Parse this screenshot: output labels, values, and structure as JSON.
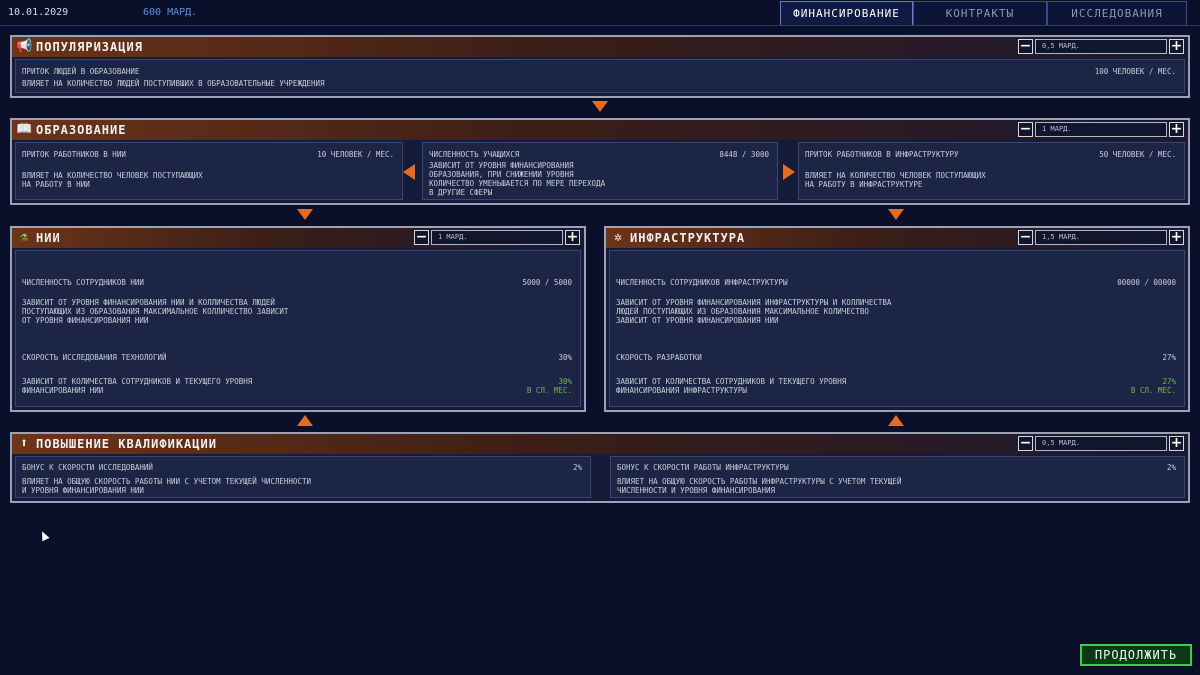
{
  "top": {
    "date": "10.01.2029",
    "money": "600 МАРД."
  },
  "tabs": [
    "ФИНАНСИРОВАНИЕ",
    "КОНТРАКТЫ",
    "ИССЛЕДОВАНИЯ"
  ],
  "popularization": {
    "title": "ПОПУЛЯРИЗАЦИЯ",
    "amount": "0,5 МАРД.",
    "label": "ПРИТОК ЛЮДЕЙ В ОБРАЗОВАНИЕ",
    "value": "100 ЧЕЛОВЕК / МЕС.",
    "desc": "ВЛИЯЕТ НА КОЛИЧЕСТВО ЛЮДЕЙ ПОСТУПИВШИХ В ОБРАЗОВАТЕЛЬНЫЕ УЧРЕЖДЕНИЯ"
  },
  "education": {
    "title": "ОБРАЗОВАНИЕ",
    "amount": "1 МАРД.",
    "left": {
      "label": "ПРИТОК РАБОТНИКОВ В НИИ",
      "value": "10 ЧЕЛОВЕК / МЕС.",
      "desc": "ВЛИЯЕТ НА КОЛИЧЕСТВО ЧЕЛОВЕК ПОСТУПАЮЩИХ\nНА РАБОТУ В НИИ"
    },
    "center": {
      "label": "ЧИСЛЕННОСТЬ УЧАЩИХСЯ",
      "value": "8448 / 3000",
      "desc": "ЗАВИСИТ ОТ УРОВНЯ ФИНАНСИРОВАНИЯ\nОБРАЗОВАНИЯ, ПРИ СНИЖЕНИИ УРОВНЯ\nКОЛИЧЕСТВО УМЕНЬШАЕТСЯ ПО МЕРЕ ПЕРЕХОДА\nВ ДРУГИЕ СФЕРЫ"
    },
    "right": {
      "label": "ПРИТОК РАБОТНИКОВ В ИНФРАСТРУКТУРУ",
      "value": "50 ЧЕЛОВЕК / МЕС.",
      "desc": "ВЛИЯЕТ НА КОЛИЧЕСТВО ЧЕЛОВЕК ПОСТУПАЮЩИХ\nНА РАБОТУ В ИНФРАСТРУКТУРЕ"
    }
  },
  "nii": {
    "title": "НИИ",
    "amount": "1 МАРД.",
    "staff_label": "ЧИСЛЕННОСТЬ СОТРУДНИКОВ НИИ",
    "staff_value": "5000 / 5000",
    "staff_desc": "ЗАВИСИТ ОТ УРОВНЯ ФИНАНСИРОВАНИЯ НИИ И КОЛЛИЧЕСТВА ЛЮДЕЙ\nПОСТУПАЮЩИХ ИЗ ОБРАЗОВАНИЯ МАКСИМАЛЬНОЕ КОЛЛИЧЕСТВО ЗАВИСИТ\nОТ УРОВНЯ ФИНАНСИРОВАНИЯ НИИ",
    "speed_label": "СКОРОСТЬ ИССЛЕДОВАНИЯ ТЕХНОЛОГИЙ",
    "speed_value": "30%",
    "speed_desc": "ЗАВИСИТ ОТ КОЛИЧЕСТВА СОТРУДНИКОВ И ТЕКУЩЕГО УРОВНЯ\nФИНАНСИРОВАНИЯ НИИ",
    "speed_delta": "30%",
    "speed_delta_unit": "В СЛ. МЕС."
  },
  "infra": {
    "title": "ИНФРАСТРУКТУРА",
    "amount": "1,5 МАРД.",
    "staff_label": "ЧИСЛЕННОСТЬ СОТРУДНИКОВ ИНФРАСТРУКТУРЫ",
    "staff_value": "00000 / 00000",
    "staff_desc": "ЗАВИСИТ ОТ УРОВНЯ ФИНАНСИРОВАНИЯ ИНФРАСТРУКТУРЫ И КОЛЛИЧЕСТВА\nЛЮДЕЙ ПОСТУПАЮЩИХ ИЗ ОБРАЗОВАНИЯ МАКСИМАЛЬНОЕ КОЛИЧЕСТВО\nЗАВИСИТ ОТ УРОВНЯ ФИНАНСИРОВАНИЯ НИИ",
    "speed_label": "СКОРОСТЬ РАЗРАБОТКИ",
    "speed_value": "27%",
    "speed_desc": "ЗАВИСИТ ОТ КОЛИЧЕСТВА СОТРУДНИКОВ И ТЕКУЩЕГО УРОВНЯ\nФИНАНСИРОВАНИЯ ИНФРАСТРУКТУРЫ",
    "speed_delta": "27%",
    "speed_delta_unit": "В СЛ. МЕС."
  },
  "qualification": {
    "title": "ПОВЫШЕНИЕ КВАЛИФИКАЦИИ",
    "amount": "0,5 МАРД.",
    "left": {
      "label": "БОНУС К СКОРОСТИ ИССЛЕДОВАНИЙ",
      "value": "2%",
      "desc": "ВЛИЯЕТ НА ОБЩУЮ СКОРОСТЬ РАБОТЫ НИИ С УЧЕТОМ ТЕКУЩЕЙ ЧИСЛЕННОСТИ\nИ УРОВНЯ ФИНАНСИРОВАНИЯ НИИ"
    },
    "right": {
      "label": "БОНУС К СКОРОСТИ РАБОТЫ ИНФРАСТРУКТУРЫ",
      "value": "2%",
      "desc": "ВЛИЯЕТ НА ОБЩУЮ СКОРОСТЬ РАБОТЫ ИНФРАСТРУКТУРЫ С УЧЕТОМ ТЕКУЩЕЙ\nЧИСЛЕННОСТИ И УРОВНЯ ФИНАНСИРОВАНИЯ"
    }
  },
  "buttons": {
    "minus": "−",
    "plus": "+",
    "continue": "ПРОДОЛЖИТЬ"
  },
  "icons": {
    "popularization": "megaphone-icon",
    "education": "book-icon",
    "nii": "flask-icon",
    "infra": "tools-icon",
    "qualification": "arrow-up-icon"
  },
  "colors": {
    "accent": "#e86a1c",
    "positive": "#6fb84b",
    "continue": "#3cd04a",
    "money": "#5a8fe0"
  }
}
